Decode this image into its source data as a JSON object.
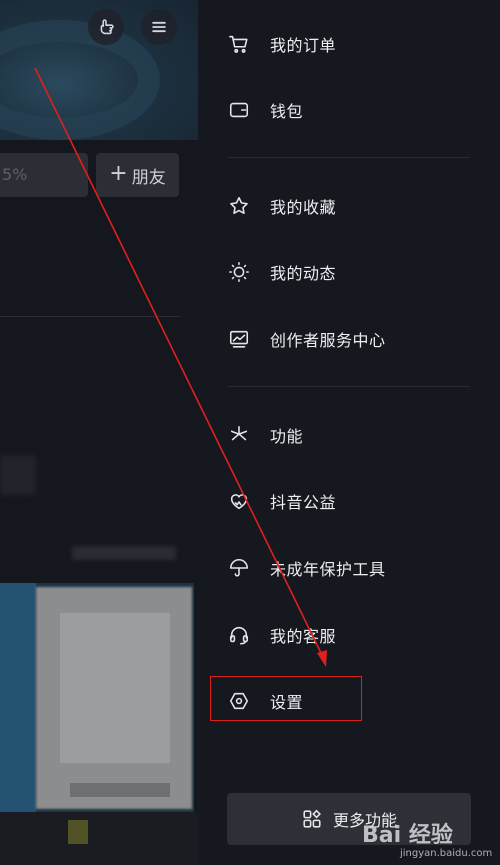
{
  "background_app": {
    "percent_text": "5%",
    "add_friend_label": "朋友",
    "add_symbol": "+"
  },
  "drawer": {
    "items": [
      {
        "label": "我的订单",
        "icon": "cart-icon"
      },
      {
        "label": "钱包",
        "icon": "wallet-icon"
      },
      {
        "label": "我的收藏",
        "icon": "star-icon"
      },
      {
        "label": "我的动态",
        "icon": "sun-icon"
      },
      {
        "label": "创作者服务中心",
        "icon": "chart-icon"
      },
      {
        "label": "功能",
        "icon": "sparkle-icon"
      },
      {
        "label": "抖音公益",
        "icon": "heart-hand-icon"
      },
      {
        "label": "未成年保护工具",
        "icon": "umbrella-icon"
      },
      {
        "label": "我的客服",
        "icon": "headset-icon"
      },
      {
        "label": "设置",
        "icon": "settings-hexagon-icon"
      }
    ],
    "more_button_label": "更多功能"
  },
  "watermark": {
    "logo_text": "Bai 经验",
    "url_text": "jingyan.baidu.com"
  },
  "colors": {
    "drawer_bg": "#161820",
    "annotation_red": "#e0201c"
  }
}
